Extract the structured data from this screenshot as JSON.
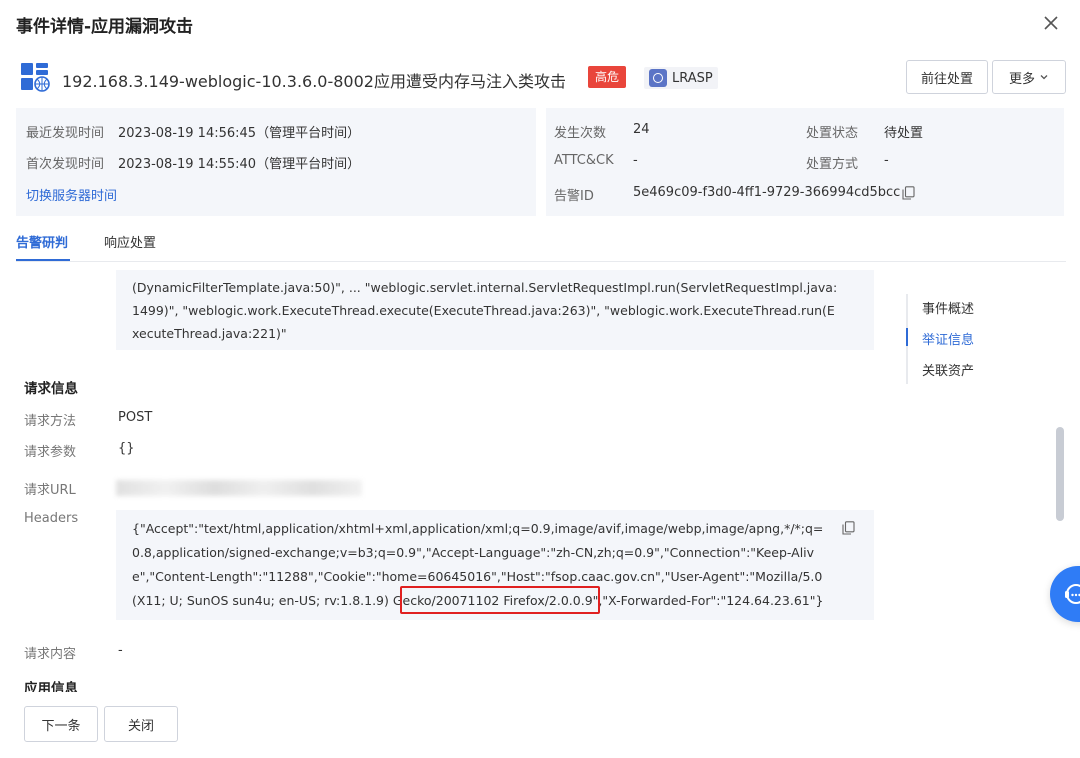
{
  "modal": {
    "title": "事件详情-应用漏洞攻击"
  },
  "event": {
    "title": "192.168.3.149-weblogic-10.3.6.0-8002应用遭受内存马注入类攻击",
    "severity_label": "高危",
    "source_label": "LRASP",
    "goto_button": "前往处置",
    "more_button": "更多"
  },
  "info": {
    "last_seen_label": "最近发现时间",
    "last_seen_value": "2023-08-19 14:56:45（管理平台时间）",
    "first_seen_label": "首次发现时间",
    "first_seen_value": "2023-08-19 14:55:40（管理平台时间）",
    "switch_time_link": "切换服务器时间",
    "count_label": "发生次数",
    "count_value": "24",
    "attck_label": "ATTC&CK",
    "attck_value": "-",
    "alert_id_label": "告警ID",
    "alert_id_value": "5e469c09-f3d0-4ff1-9729-366994cd5bcc",
    "status_label": "处置状态",
    "status_value": "待处置",
    "method_label": "处置方式",
    "method_value": "-"
  },
  "tabs": [
    {
      "label": "告警研判"
    },
    {
      "label": "响应处置"
    }
  ],
  "stack": {
    "text": "(DynamicFilterTemplate.java:50)\", ... \"weblogic.servlet.internal.ServletRequestImpl.run(ServletRequestImpl.java:1499)\", \"weblogic.work.ExecuteThread.execute(ExecuteThread.java:263)\", \"weblogic.work.ExecuteThread.run(ExecuteThread.java:221)\""
  },
  "anchors": [
    {
      "label": "事件概述"
    },
    {
      "label": "举证信息"
    },
    {
      "label": "关联资产"
    }
  ],
  "request": {
    "section_title": "请求信息",
    "method_label": "请求方法",
    "method_value": "POST",
    "params_label": "请求参数",
    "params_value": "{}",
    "url_label": "请求URL",
    "headers_label": "Headers",
    "headers_value": "{\"Accept\":\"text/html,application/xhtml+xml,application/xml;q=0.9,image/avif,image/webp,image/apng,*/*;q=0.8,application/signed-exchange;v=b3;q=0.9\",\"Accept-Language\":\"zh-CN,zh;q=0.9\",\"Connection\":\"Keep-Alive\",\"Content-Length\":\"11288\",\"Cookie\":\"home=60645016\",\"Host\":\"fsop.caac.gov.cn\",\"User-Agent\":\"Mozilla/5.0 (X11; U; SunOS sun4u; en-US; rv:1.8.1.9) Gecko/20071102 Firefox/2.0.0.9\",\"X-Forwarded-For\":\"124.64.23.61\"}",
    "body_label": "请求内容",
    "body_value": "-"
  },
  "next_section_title": "应用信息",
  "footer": {
    "next_button": "下一条",
    "close_button": "关闭"
  },
  "colors": {
    "accent": "#2f6bd6",
    "danger": "#e9453b",
    "highlight": "#e02020",
    "panel_bg": "#f4f6fa"
  }
}
